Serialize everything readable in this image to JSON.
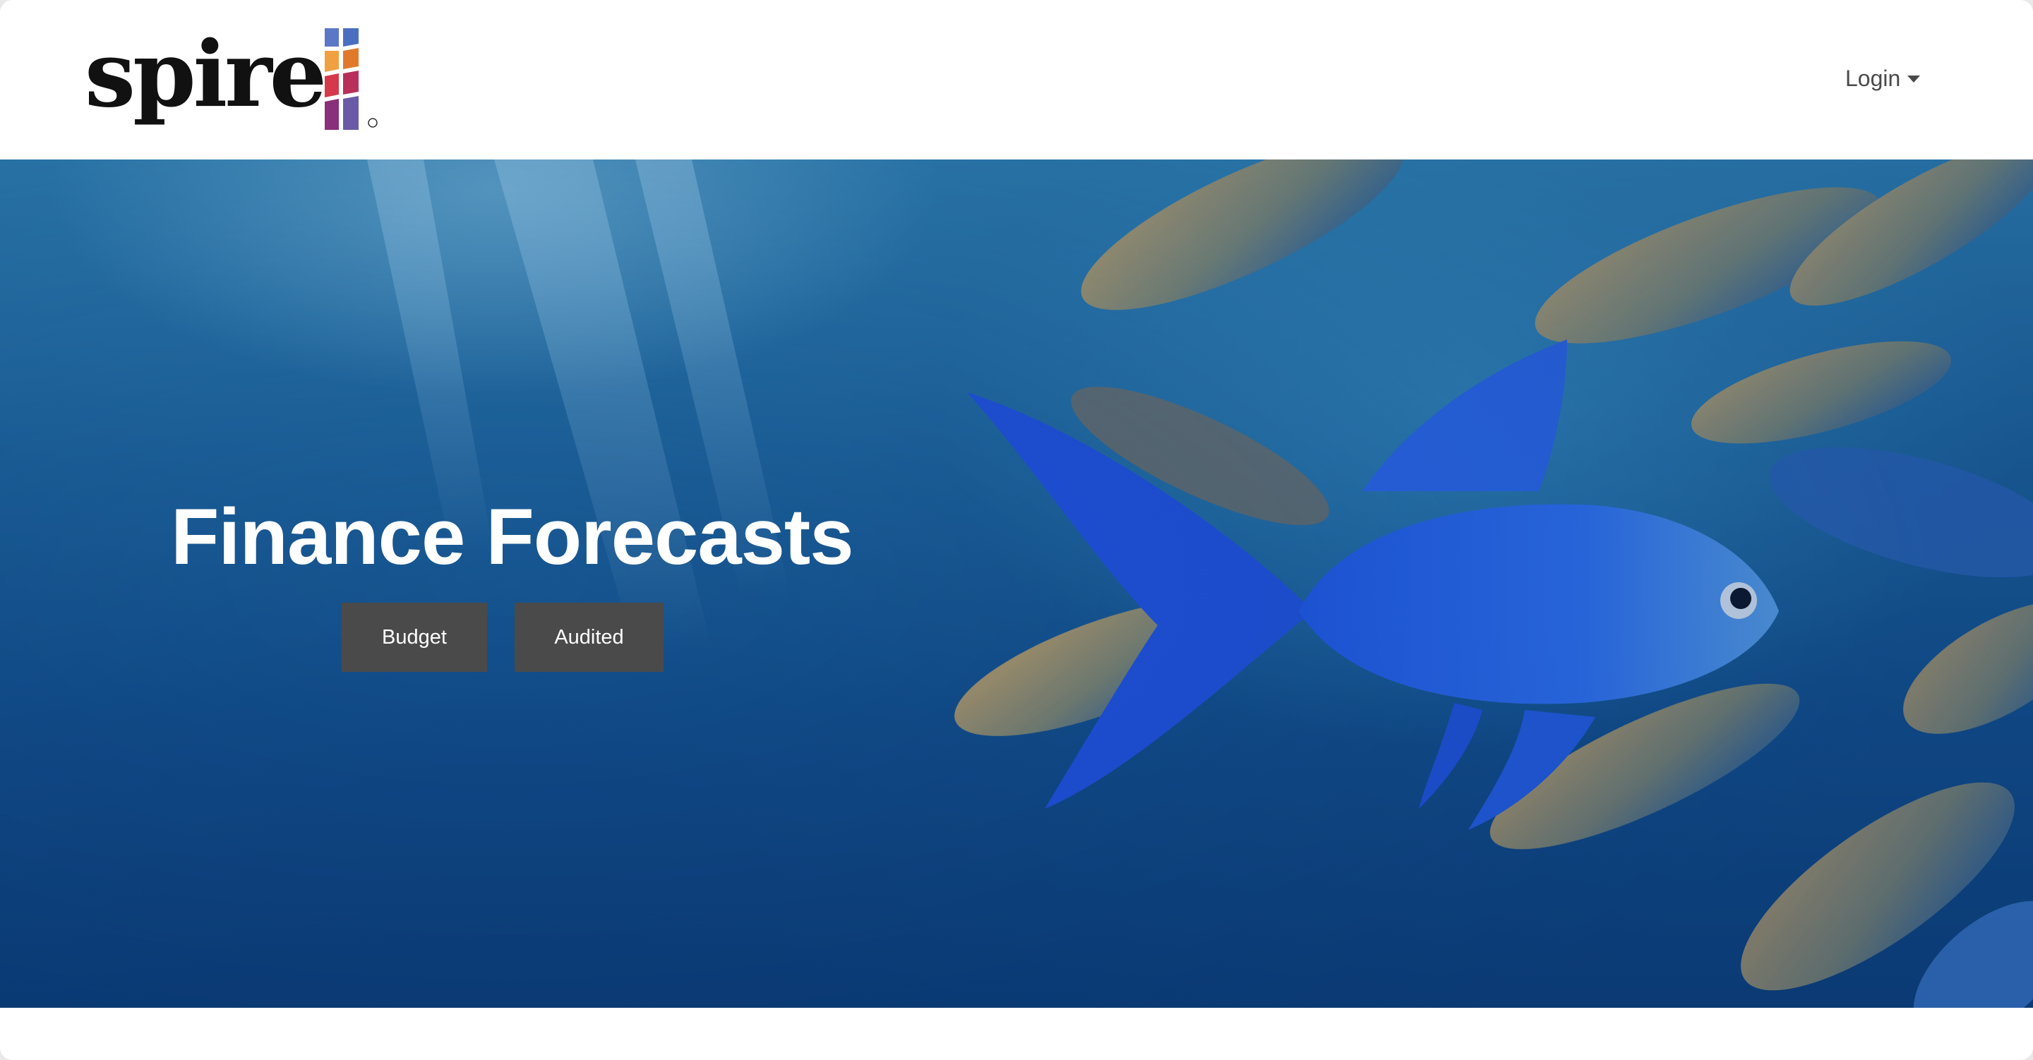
{
  "brand": {
    "name": "spire",
    "registered_mark": "®",
    "mark_colors": [
      "#5b78c7",
      "#e07a2a",
      "#d6394b",
      "#8a2f7a",
      "#6a5aa8"
    ]
  },
  "nav": {
    "login_label": "Login",
    "login_icon": "caret-down-icon"
  },
  "hero": {
    "title": "Finance Forecasts",
    "buttons": [
      {
        "label": "Budget"
      },
      {
        "label": "Audited"
      }
    ],
    "background": "underwater-blue-fish-photo"
  },
  "colors": {
    "button_bg": "#4a4a4a",
    "button_text": "#ffffff",
    "title_text": "#ffffff",
    "nav_text": "#4a4a4a"
  }
}
